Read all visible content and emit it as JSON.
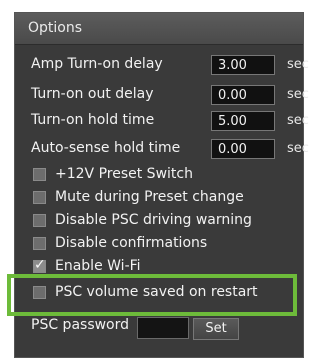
{
  "panel": {
    "title": "Options"
  },
  "fields": [
    {
      "label": "Amp Turn-on delay",
      "value": "3.00",
      "unit": "sec"
    },
    {
      "label": "Turn-on out delay",
      "value": "0.00",
      "unit": "sec"
    },
    {
      "label": "Turn-on hold time",
      "value": "5.00",
      "unit": "sec"
    },
    {
      "label": "Auto-sense hold time",
      "value": "0.00",
      "unit": "sec"
    }
  ],
  "checkboxes": [
    {
      "label": "+12V Preset Switch",
      "checked": false
    },
    {
      "label": "Mute during Preset change",
      "checked": false
    },
    {
      "label": "Disable PSC driving warning",
      "checked": false
    },
    {
      "label": "Disable confirmations",
      "checked": false
    },
    {
      "label": "Enable Wi-Fi",
      "checked": true
    },
    {
      "label": "PSC volume saved on restart",
      "checked": false
    }
  ],
  "password": {
    "label": "PSC password",
    "value": "",
    "button": "Set"
  },
  "colors": {
    "highlight": "#6dbb3a",
    "panel_bg": "#3a3a3a"
  }
}
